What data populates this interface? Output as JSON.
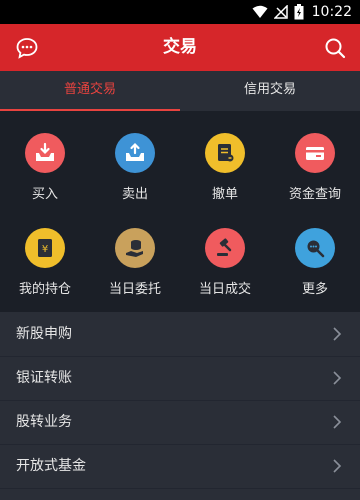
{
  "status_bar": {
    "time": "10:22"
  },
  "header": {
    "title": "交易"
  },
  "tabs": [
    {
      "label": "普通交易",
      "active": true
    },
    {
      "label": "信用交易",
      "active": false
    }
  ],
  "functions": [
    {
      "label": "买入",
      "icon": "buy-icon",
      "color": "#f05b5e"
    },
    {
      "label": "卖出",
      "icon": "sell-icon",
      "color": "#3e93d6"
    },
    {
      "label": "撤单",
      "icon": "cancel-order-icon",
      "color": "#f0be2b"
    },
    {
      "label": "资金查询",
      "icon": "funds-query-icon",
      "color": "#f05b5e"
    },
    {
      "label": "我的持仓",
      "icon": "holdings-icon",
      "color": "#f0be2b"
    },
    {
      "label": "当日委托",
      "icon": "daily-orders-icon",
      "color": "#c9a15c"
    },
    {
      "label": "当日成交",
      "icon": "daily-deals-icon",
      "color": "#f05b5e"
    },
    {
      "label": "更多",
      "icon": "more-icon",
      "color": "#3fa2dd"
    }
  ],
  "menu": [
    {
      "label": "新股申购"
    },
    {
      "label": "银证转账"
    },
    {
      "label": "股转业务"
    },
    {
      "label": "开放式基金"
    }
  ],
  "colors": {
    "brand": "#d6262a",
    "active_tab": "#e8433f",
    "background": "#1e222b"
  }
}
